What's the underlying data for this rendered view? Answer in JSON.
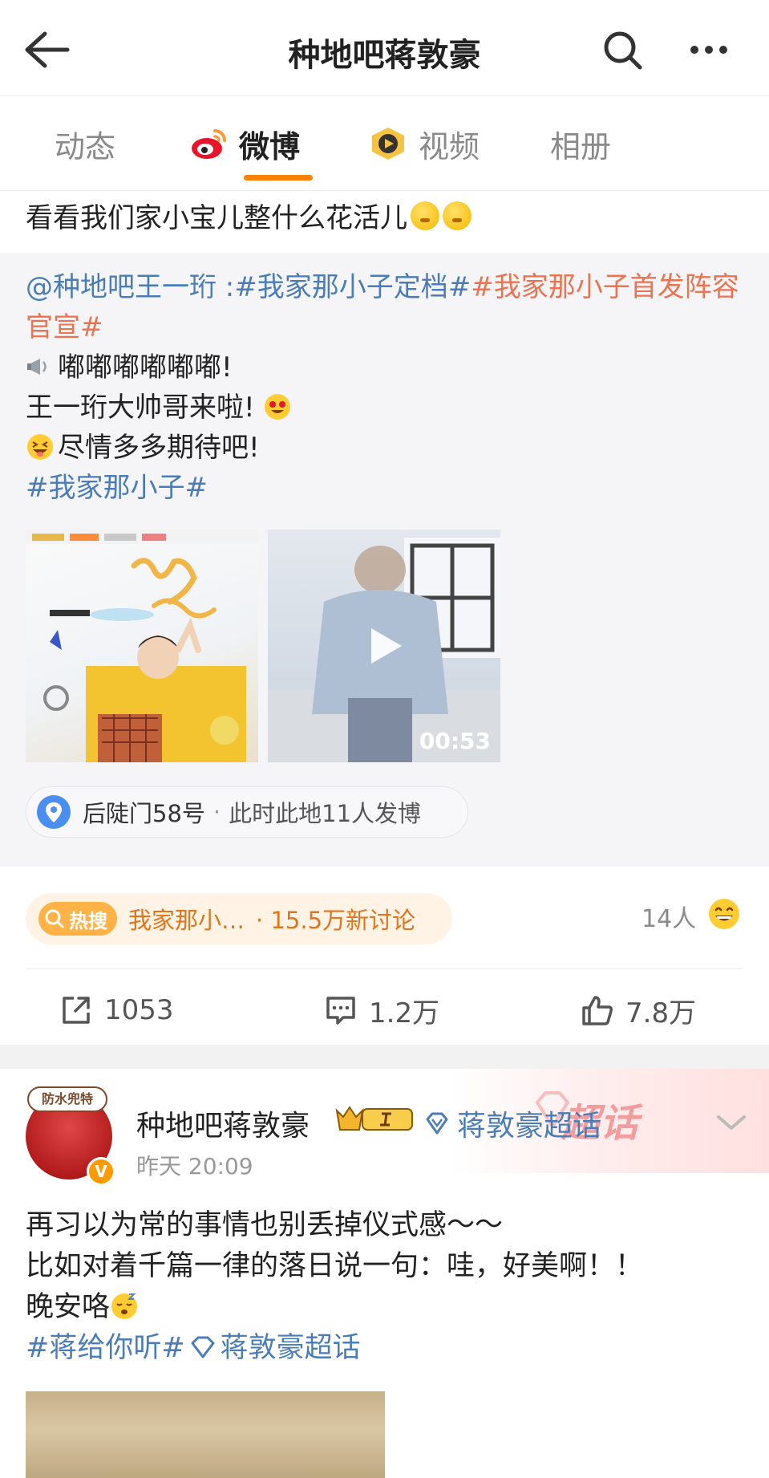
{
  "header": {
    "title": "种地吧蒋敦豪"
  },
  "tabs": [
    {
      "label": "动态"
    },
    {
      "label": "微博"
    },
    {
      "label": "视频"
    },
    {
      "label": "相册"
    }
  ],
  "post1": {
    "intro_text": "看看我们家小宝儿整什么花活儿",
    "repost": {
      "mention": "@种地吧王一珩",
      "colon": " :",
      "tag1": "#我家那小子定档#",
      "tag2": "#我家那小子首发阵容官宣#",
      "line1": "嘟嘟嘟嘟嘟嘟!",
      "line2": "王一珩大帅哥来啦!",
      "line3": "尽情多多期待吧!",
      "tag3": "#我家那小子#"
    },
    "media": {
      "video_duration": "00:53"
    },
    "location": {
      "name": "后陡门58号",
      "separator": "·",
      "note": "此时此地11人发博"
    },
    "hot_search": {
      "badge": "热搜",
      "topic": "我家那小…",
      "count": "· 15.5万新讨论"
    },
    "reactions": {
      "count": "14人",
      "icon": "grin-emoji"
    },
    "actions": {
      "repost": "1053",
      "comment": "1.2万",
      "like": "7.8万"
    }
  },
  "post2": {
    "banner_word": "超话",
    "avatar_badge": "防水兜特",
    "verified_mark": "V",
    "user_name": "种地吧蒋敦豪",
    "topic_name": "蒋敦豪超话",
    "time": "昨天 20:09",
    "line1": "再习以为常的事情也别丢掉仪式感～～",
    "line2": "比如对着千篇一律的落日说一句：哇，好美啊！！",
    "line3": "晚安咯",
    "tag_a": "#蒋给你听#",
    "tag_b": "蒋敦豪超话"
  },
  "colors": {
    "accent_orange": "#ff8200",
    "link_blue": "#4a7db8",
    "tag_orange": "#eb7350",
    "hot_bg": "#fff3e6"
  }
}
